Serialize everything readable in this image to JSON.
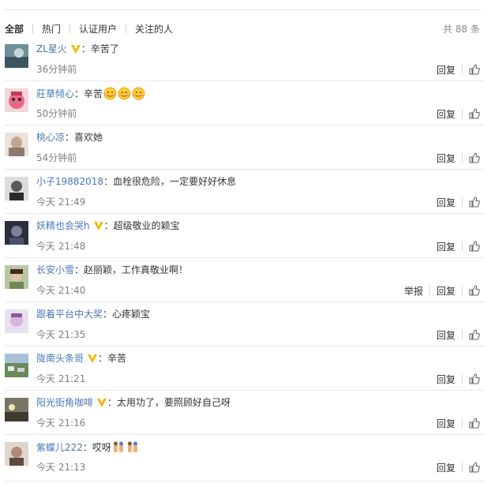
{
  "tabs": [
    "全部",
    "热门",
    "认证用户",
    "关注的人"
  ],
  "total": "共 88 条",
  "actions": {
    "report": "举报",
    "reply": "回复"
  },
  "comments": [
    {
      "user": "ZL星火",
      "verified": true,
      "text": "：辛苦了",
      "time": "36分钟前"
    },
    {
      "user": "莊草倾心",
      "verified": false,
      "text": "：辛苦",
      "time": "50分钟前",
      "emojis": 3
    },
    {
      "user": "桃心凉",
      "verified": false,
      "text": "：喜欢她",
      "time": "54分钟前"
    },
    {
      "user": "小子19882018",
      "verified": false,
      "text": "：血栓很危险，一定要好好休息",
      "time": "今天 21:49"
    },
    {
      "user": "妖精也会哭h",
      "verified": true,
      "text": "：超级敬业的颖宝",
      "time": "今天 21:48"
    },
    {
      "user": "长安小雪",
      "verified": false,
      "text": "：赵丽颖，工作真敬业啊！",
      "time": "今天 21:40",
      "report": true
    },
    {
      "user": "跟着平台中大奖",
      "verified": false,
      "text": "：心疼颖宝",
      "time": "今天 21:35"
    },
    {
      "user": "陇南头条哥",
      "verified": true,
      "text": "：辛苦",
      "time": "今天 21:21"
    },
    {
      "user": "阳光街角咖啡",
      "verified": true,
      "text": "：太用功了，要照顾好自己呀",
      "time": "今天 21:16"
    },
    {
      "user": "紫蝶儿222",
      "verified": false,
      "text": "：哎呀",
      "time": "今天 21:13",
      "emojis": 2
    }
  ]
}
